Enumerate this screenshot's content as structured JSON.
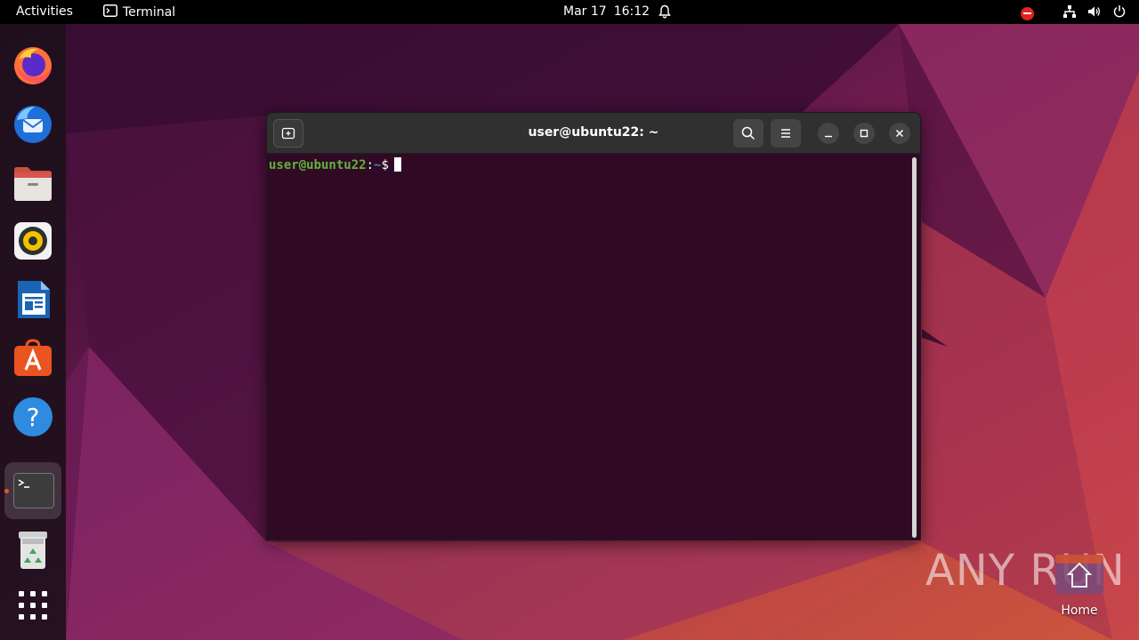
{
  "topbar": {
    "activities_label": "Activities",
    "app_name": "Terminal",
    "date": "Mar 17",
    "time": "16:12",
    "icons": [
      "terminal-icon",
      "bell-icon",
      "do-not-disturb-icon",
      "network-icon",
      "volume-icon",
      "power-icon"
    ]
  },
  "dock": {
    "items": [
      {
        "name": "firefox-icon"
      },
      {
        "name": "thunderbird-icon"
      },
      {
        "name": "files-icon"
      },
      {
        "name": "rhythmbox-icon"
      },
      {
        "name": "libreoffice-writer-icon"
      },
      {
        "name": "app-center-icon"
      },
      {
        "name": "help-icon"
      },
      {
        "name": "terminal-icon",
        "running": true
      },
      {
        "name": "trash-icon"
      },
      {
        "name": "show-apps-icon"
      }
    ]
  },
  "terminal": {
    "title": "user@ubuntu22: ~",
    "prompt_user": "user@ubuntu22",
    "prompt_sep": ":",
    "prompt_path": "~",
    "prompt_symbol": "$"
  },
  "desktop": {
    "watermark": "ANY  RUN",
    "home_label": "Home"
  },
  "colors": {
    "topbar": "#000000",
    "terminal_bg": "#300a24",
    "prompt_user": "#5fb43a",
    "prompt_path": "#3a8ad6",
    "accent": "#e95420"
  }
}
